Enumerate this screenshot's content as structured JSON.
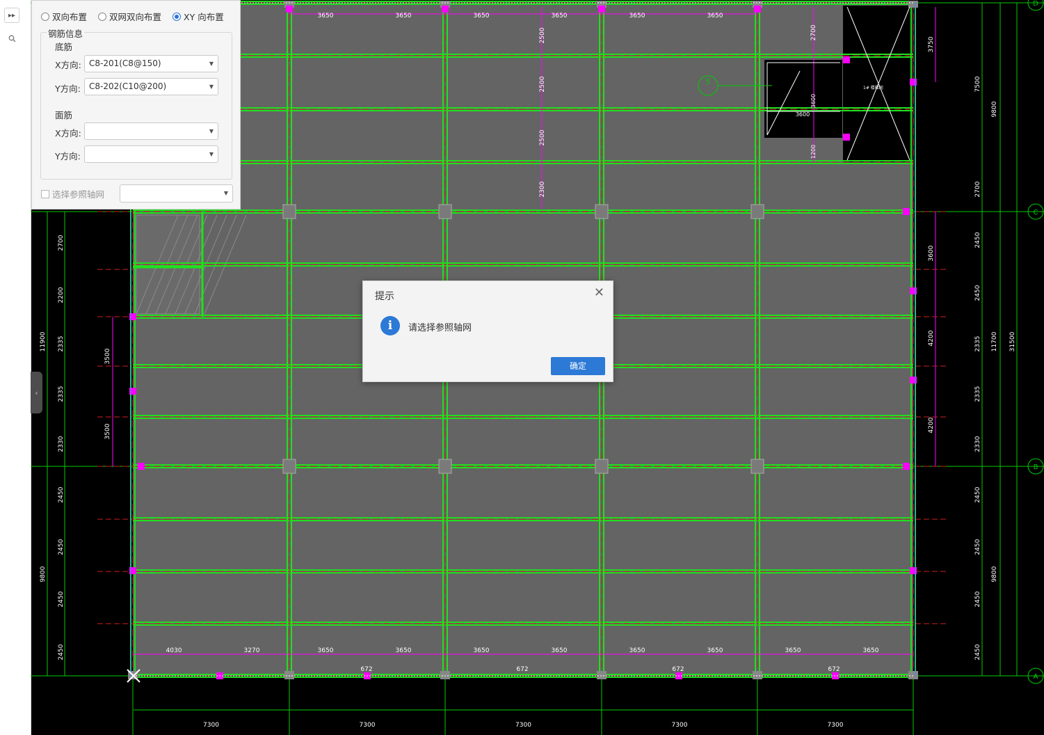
{
  "toolbar": {
    "expand_icon": "double-chevron-right-icon",
    "search_icon": "search-icon"
  },
  "panel": {
    "layout_options": [
      {
        "label": "双向布置",
        "selected": false
      },
      {
        "label": "双网双向布置",
        "selected": false
      },
      {
        "label": "XY 向布置",
        "selected": true
      }
    ],
    "group_title": "钢筋信息",
    "bottom_rebar": {
      "title": "底筋",
      "x_label": "X方向:",
      "x_value": "C8-201(C8@150)",
      "y_label": "Y方向:",
      "y_value": "C8-202(C10@200)"
    },
    "top_rebar": {
      "title": "面筋",
      "x_label": "X方向:",
      "x_value": "",
      "y_label": "Y方向:",
      "y_value": ""
    },
    "ref_grid_checkbox": "选择参照轴网",
    "ref_grid_checked": false,
    "ref_grid_value": ""
  },
  "dialog": {
    "title": "提示",
    "message": "请选择参照轴网",
    "ok_label": "确定",
    "close_icon": "close-icon",
    "info_icon": "info-icon"
  },
  "drawing": {
    "axis_labels": [
      "D",
      "C",
      "B",
      "A"
    ],
    "span_labels": [
      "7300",
      "7300",
      "7300",
      "7300",
      "7300"
    ],
    "sub_span_labels": [
      "3650",
      "3650",
      "3650",
      "3650",
      "3650",
      "3650"
    ],
    "bottom_sub_labels": [
      "4030",
      "3270",
      "3650",
      "3650",
      "3650",
      "3650",
      "3650",
      "3650",
      "3650",
      "3650"
    ],
    "slab_marks": [
      "672",
      "672",
      "672",
      "672"
    ],
    "left_dims": [
      "2700",
      "2200",
      "2335",
      "2335",
      "2330",
      "2450",
      "2450",
      "2450",
      "2450"
    ],
    "left_totals": [
      "11900",
      "9800"
    ],
    "left_inner_dims": [
      "3500",
      "3500"
    ],
    "right_dims": [
      "2700",
      "2450",
      "2450",
      "2335",
      "2335",
      "2330",
      "2450",
      "2450",
      "2450",
      "2450"
    ],
    "right_totals": [
      "7500",
      "9800",
      "11700",
      "9800",
      "31500"
    ],
    "right_inner_dims": [
      "3750",
      "3600",
      "4200",
      "4200"
    ],
    "top_inner_dims": [
      "2700",
      "2500",
      "2500",
      "2500",
      "2300"
    ],
    "opening_dims": [
      "3600",
      "3600",
      "1200"
    ],
    "section_mark": "5",
    "stair_label": "1# 楼梯间",
    "colors": {
      "beam": "#1fe01f",
      "slab": "#646464",
      "pink": "#ff00ff",
      "grid": "#00cc00",
      "red": "#cc2020",
      "white": "#ffffff"
    }
  }
}
